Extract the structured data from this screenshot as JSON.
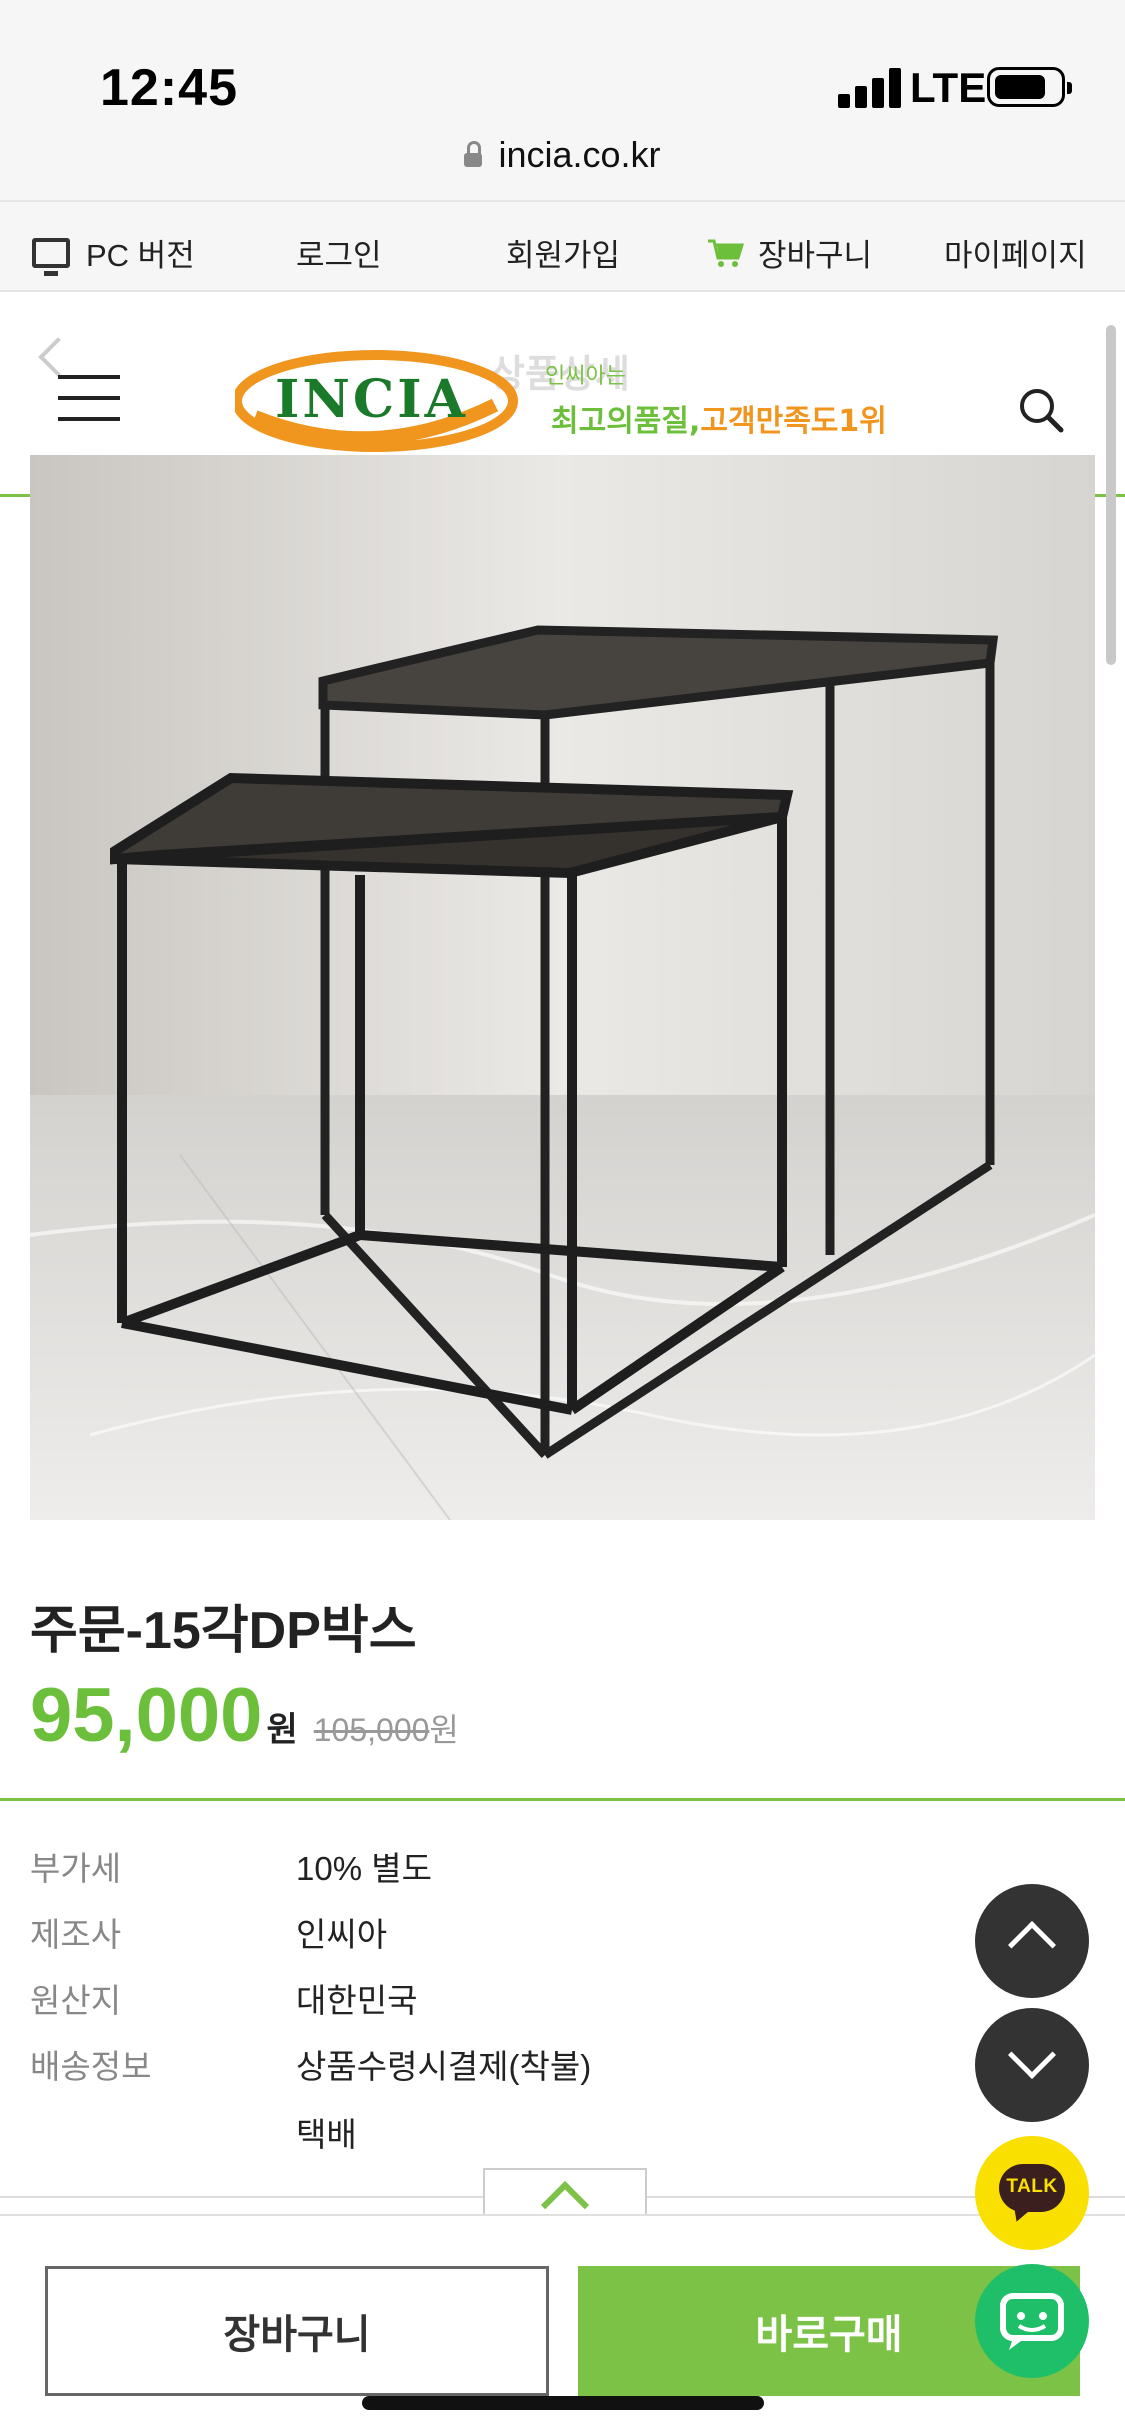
{
  "status_bar": {
    "time": "12:45",
    "network": "LTE",
    "url": "incia.co.kr"
  },
  "top_nav": {
    "pc_version": "PC 버전",
    "login": "로그인",
    "signup": "회원가입",
    "cart": "장바구니",
    "mypage": "마이페이지"
  },
  "header": {
    "ghost_title": "상품상세",
    "logo_text": "INCIA",
    "logo_sub": "인씨아는",
    "logo_slogan_part1": "최고의품질,",
    "logo_slogan_part2": "고객만족도1위"
  },
  "product": {
    "name": "주문-15각DP박스",
    "price": "95,000",
    "price_unit": "원",
    "original_price": "105,000",
    "original_unit": "원"
  },
  "specs": [
    {
      "label": "부가세",
      "value": "10% 별도"
    },
    {
      "label": "제조사",
      "value": "인씨아"
    },
    {
      "label": "원산지",
      "value": "대한민국"
    },
    {
      "label": "배송정보",
      "value": "상품수령시결제(착불)"
    },
    {
      "label": "",
      "value": "택배"
    }
  ],
  "buttons": {
    "cart": "장바구니",
    "buy": "바로구매",
    "talk": "TALK"
  },
  "colors": {
    "accent": "#7cc246",
    "price": "#6cbf3a",
    "logo_orange": "#f0951e",
    "kakao": "#f9e000",
    "chat": "#1fbf6a"
  }
}
